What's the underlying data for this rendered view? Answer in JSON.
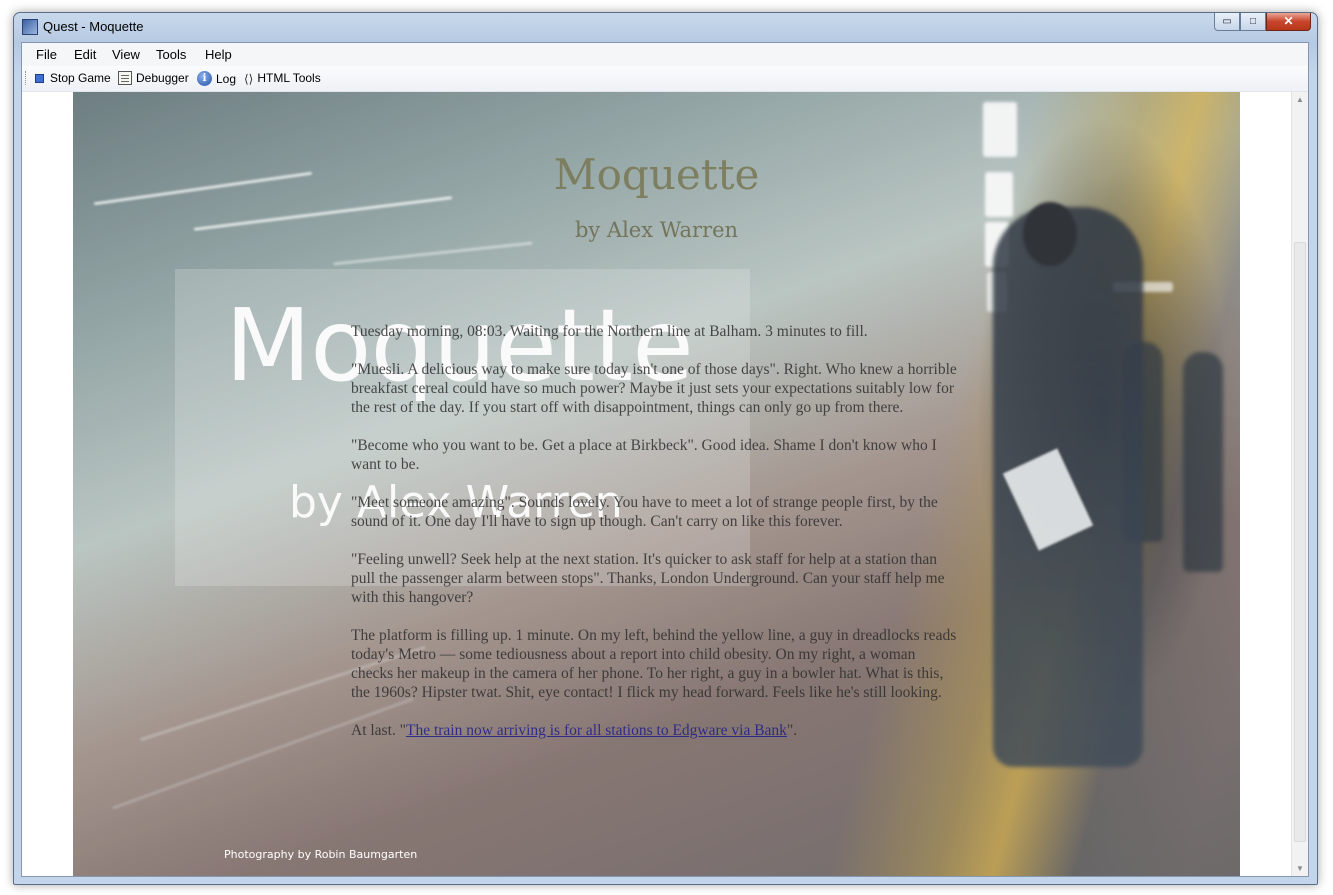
{
  "window": {
    "title": "Quest - Moquette",
    "minimize": "▭",
    "maximize": "□",
    "close": "✕"
  },
  "menu": {
    "file": "File",
    "edit": "Edit",
    "view": "View",
    "tools": "Tools",
    "help": "Help"
  },
  "toolbar": {
    "stop_game": "Stop Game",
    "debugger": "Debugger",
    "log": "Log",
    "html_tools": "HTML Tools",
    "log_icon_glyph": "i"
  },
  "game": {
    "title": "Moquette",
    "author": "by Alex Warren",
    "cover_title": "Moquette",
    "cover_author": "by Alex Warren",
    "credit": "Photography by Robin Baumgarten",
    "paragraphs": [
      "Tuesday morning, 08:03. Waiting for the Northern line at Balham. 3 minutes to fill.",
      "\"Muesli. A delicious way to make sure today isn't one of those days\". Right. Who knew a horrible breakfast cereal could have so much power? Maybe it just sets your expectations suitably low for the rest of the day. If you start off with disappointment, things can only go up from there.",
      "\"Become who you want to be. Get a place at Birkbeck\". Good idea. Shame I don't know who I want to be.",
      "\"Meet someone amazing\". Sounds lovely. You have to meet a lot of strange people first, by the sound of it. One day I'll have to sign up though. Can't carry on like this forever.",
      "\"Feeling unwell? Seek help at the next station. It's quicker to ask staff for help at a station than pull the passenger alarm between stops\". Thanks, London Underground. Can your staff help me with this hangover?",
      "The platform is filling up. 1 minute. On my left, behind the yellow line, a guy in dreadlocks reads today's Metro — some tediousness about a report into child obesity. On my right, a woman checks her makeup in the camera of her phone. To her right, a guy in a bowler hat. What is this, the 1960s? Hipster twat. Shit, eye contact! I flick my head forward. Feels like he's still looking."
    ],
    "last_prefix": "At last. \"",
    "last_link": "The train now arriving is for all stations to Edgware via Bank",
    "last_suffix": "\"."
  },
  "colors": {
    "title_bar": "#c9d9ec",
    "close_button": "#c8452c",
    "link": "#1a1a8c"
  }
}
